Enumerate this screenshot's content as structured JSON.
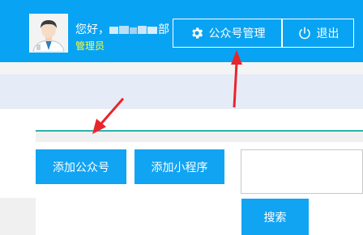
{
  "header": {
    "greeting_prefix": "您好，",
    "greeting_suffix": "部",
    "role": "管理员",
    "manage_label": "公众号管理",
    "logout_label": "退出"
  },
  "main": {
    "add_official_account_label": "添加公众号",
    "add_mini_program_label": "添加小程序",
    "search_placeholder": "",
    "search_label": "搜索"
  },
  "icons": {
    "manage": "gear-icon",
    "logout": "power-icon",
    "avatar": "user-avatar"
  },
  "colors": {
    "header_bg": "#09a3f3",
    "button_bg": "#10a4f3",
    "role_text": "#ffff33",
    "annotation_arrow": "#e8262b",
    "divider": "#2db2a8"
  }
}
